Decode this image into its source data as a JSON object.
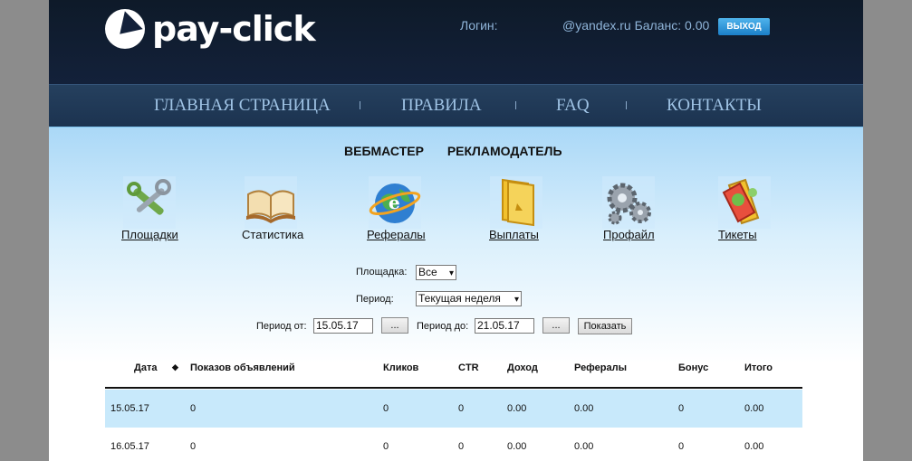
{
  "brand": {
    "name": "pay-click"
  },
  "account": {
    "login_label": "Логин:",
    "login_value": "@yandex.ru Баланс: 0.00",
    "logout_label": "ВЫХОД"
  },
  "nav": {
    "items": [
      "ГЛАВНАЯ СТРАНИЦА",
      "ПРАВИЛА",
      "FAQ",
      "КОНТАКТЫ"
    ]
  },
  "roles": [
    "ВЕБМАСТЕР",
    "РЕКЛАМОДАТЕЛЬ"
  ],
  "menu": [
    {
      "label": "Площадки",
      "icon": "tools-icon"
    },
    {
      "label": "Статистика",
      "icon": "book-icon"
    },
    {
      "label": "Рефералы",
      "icon": "globe-icon"
    },
    {
      "label": "Выплаты",
      "icon": "document-icon"
    },
    {
      "label": "Профайл",
      "icon": "gears-icon"
    },
    {
      "label": "Тикеты",
      "icon": "ticket-icon"
    }
  ],
  "filters": {
    "site_label": "Площадка:",
    "site_value": "Все",
    "period_label": "Период:",
    "period_value": "Текущая неделя",
    "from_label": "Период от:",
    "from_value": "15.05.17",
    "to_label": "Период до:",
    "to_value": "21.05.17",
    "picker_label": "...",
    "show_label": "Показать"
  },
  "table": {
    "columns": [
      "Дата",
      "Показов объявлений",
      "Кликов",
      "CTR",
      "Доход",
      "Рефералы",
      "Бонус",
      "Итого"
    ],
    "sort_icon": "sort-icon",
    "rows": [
      [
        "15.05.17",
        "0",
        "0",
        "0",
        "0.00",
        "0.00",
        "0",
        "0.00"
      ],
      [
        "16.05.17",
        "0",
        "0",
        "0",
        "0.00",
        "0.00",
        "0",
        "0.00"
      ]
    ]
  },
  "colors": {
    "header_bg": "#0e1a29",
    "nav_bg": "#1f3855",
    "accent": "#1b7fc8",
    "row_alt": "#c8e9fb"
  }
}
